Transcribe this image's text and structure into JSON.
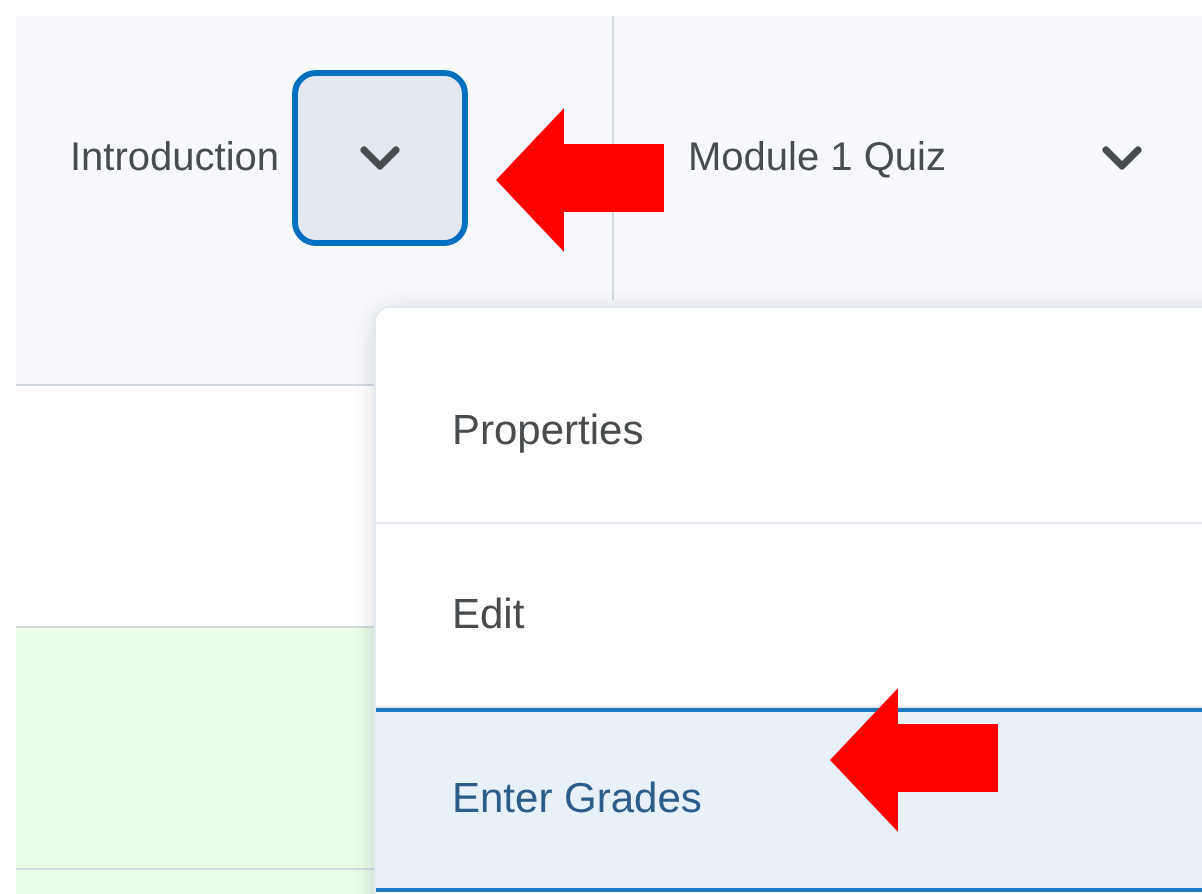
{
  "columns": [
    {
      "label": "Introduction",
      "menu_open": true
    },
    {
      "label": "Module 1 Quiz",
      "menu_open": false
    }
  ],
  "rows": [
    {
      "highlighted": false
    },
    {
      "highlighted": true
    },
    {
      "highlighted": true
    }
  ],
  "menu": {
    "items": [
      {
        "label": "Properties",
        "selected": false
      },
      {
        "label": "Edit",
        "selected": false
      },
      {
        "label": "Enter Grades",
        "selected": true
      }
    ]
  }
}
